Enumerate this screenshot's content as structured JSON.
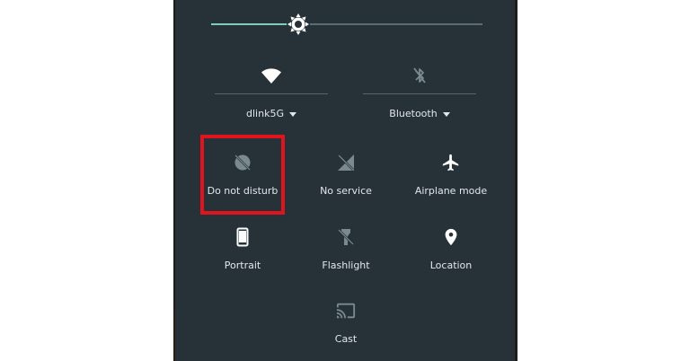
{
  "brightness": {
    "level": 0.32,
    "icon": "brightness-icon"
  },
  "top_tiles": [
    {
      "label": "dlink5G",
      "icon": "wifi-icon",
      "enabled": true
    },
    {
      "label": "Bluetooth",
      "icon": "bluetooth-off-icon",
      "enabled": false
    }
  ],
  "tiles": [
    {
      "label": "Do not disturb",
      "icon": "do-not-disturb-icon",
      "highlighted": true
    },
    {
      "label": "No service",
      "icon": "no-signal-icon"
    },
    {
      "label": "Airplane mode",
      "icon": "airplane-icon"
    },
    {
      "label": "Portrait",
      "icon": "portrait-icon"
    },
    {
      "label": "Flashlight",
      "icon": "flashlight-icon"
    },
    {
      "label": "Location",
      "icon": "location-icon"
    },
    {
      "label": "Cast",
      "icon": "cast-icon"
    }
  ],
  "colors": {
    "panel": "#263238",
    "accent": "#80cbc4",
    "highlight": "#e0141e",
    "text": "#e3e7e9",
    "icon_dim": "#7b8a91"
  }
}
